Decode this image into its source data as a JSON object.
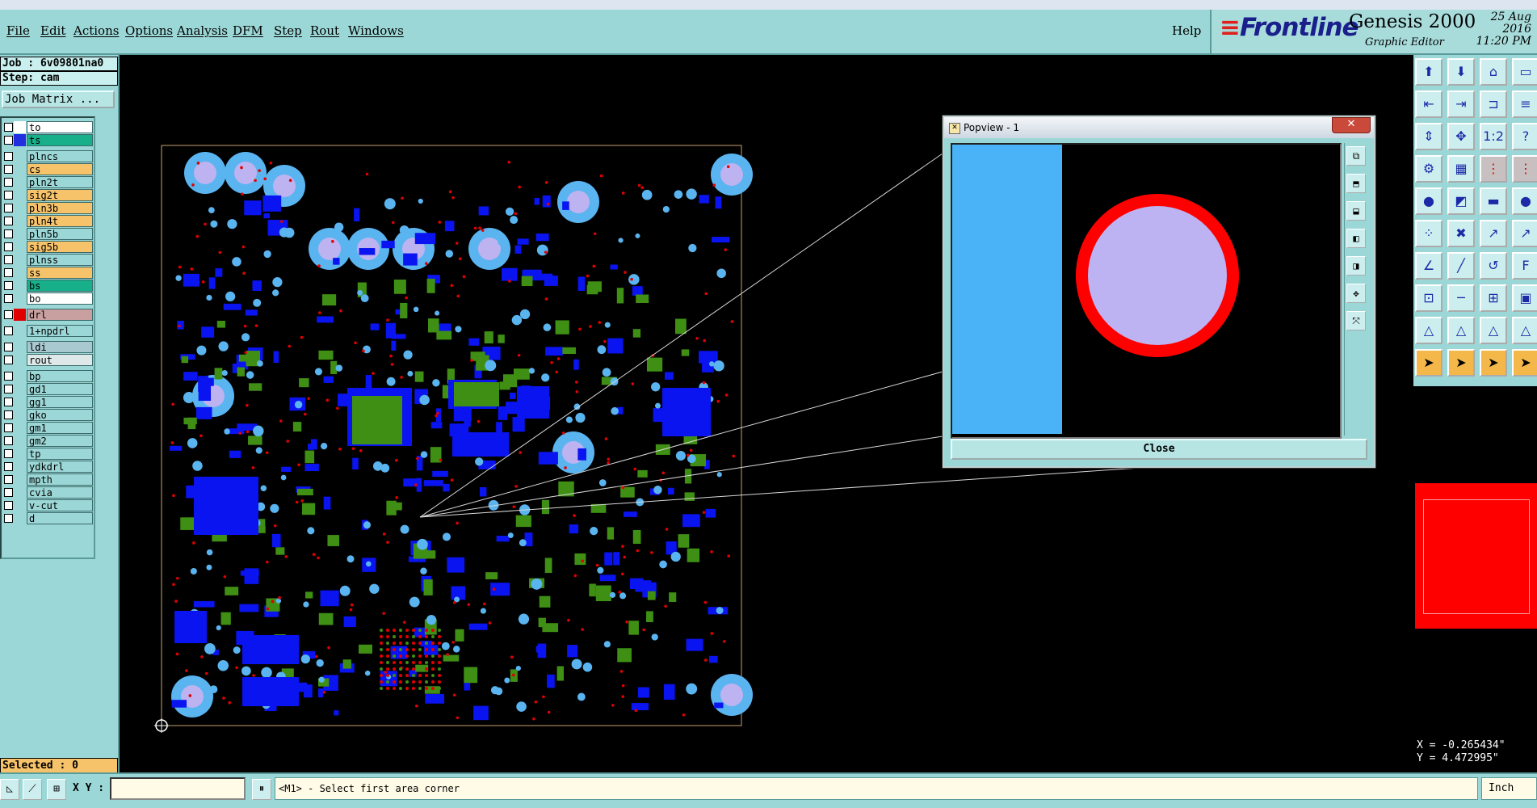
{
  "menu": {
    "items": [
      "File",
      "Edit",
      "Actions",
      "Options",
      "Analysis",
      "DFM",
      "Step",
      "Rout",
      "Windows"
    ],
    "help": "Help"
  },
  "brand": {
    "logo": "Frontline",
    "product": "Genesis 2000",
    "subtitle": "Graphic Editor",
    "date": "25 Aug 2016",
    "time": "11:20 PM"
  },
  "job": {
    "job_line": "Job : 6v09801na0",
    "step_line": "Step: cam",
    "matrix_button": "Job Matrix ..."
  },
  "layers": [
    {
      "name": "to",
      "color": "#ffffff",
      "highlight": "#ffffff"
    },
    {
      "name": "ts",
      "color": "#2030e0",
      "highlight": "#18b08a"
    },
    {
      "name": "plncs",
      "color": "#9bd7d6",
      "highlight": "#9bd7d6"
    },
    {
      "name": "cs",
      "color": "#9bd7d6",
      "highlight": "#f6c36a"
    },
    {
      "name": "pln2t",
      "color": "#9bd7d6",
      "highlight": "#9bd7d6"
    },
    {
      "name": "sig2t",
      "color": "#9bd7d6",
      "highlight": "#f6c36a"
    },
    {
      "name": "pln3b",
      "color": "#9bd7d6",
      "highlight": "#f6c36a"
    },
    {
      "name": "pln4t",
      "color": "#9bd7d6",
      "highlight": "#f6c36a"
    },
    {
      "name": "pln5b",
      "color": "#9bd7d6",
      "highlight": "#9bd7d6"
    },
    {
      "name": "sig5b",
      "color": "#9bd7d6",
      "highlight": "#f6c36a"
    },
    {
      "name": "plnss",
      "color": "#9bd7d6",
      "highlight": "#9bd7d6"
    },
    {
      "name": "ss",
      "color": "#9bd7d6",
      "highlight": "#f6c36a"
    },
    {
      "name": "bs",
      "color": "#9bd7d6",
      "highlight": "#18b08a"
    },
    {
      "name": "bo",
      "color": "#9bd7d6",
      "highlight": "#ffffff"
    },
    {
      "name": "drl",
      "color": "#e00000",
      "highlight": "#c9a0a0"
    },
    {
      "name": "1+npdrl",
      "color": "#9bd7d6",
      "highlight": "#9bd7d6"
    },
    {
      "name": "ldi",
      "color": "#9bd7d6",
      "highlight": "#a9c9d0"
    },
    {
      "name": "rout",
      "color": "#9bd7d6",
      "highlight": "#dfe8e8"
    },
    {
      "name": "bp",
      "color": "#9bd7d6",
      "highlight": "#9bd7d6"
    },
    {
      "name": "gd1",
      "color": "#9bd7d6",
      "highlight": "#9bd7d6"
    },
    {
      "name": "gg1",
      "color": "#9bd7d6",
      "highlight": "#9bd7d6"
    },
    {
      "name": "gko",
      "color": "#9bd7d6",
      "highlight": "#9bd7d6"
    },
    {
      "name": "gm1",
      "color": "#9bd7d6",
      "highlight": "#9bd7d6"
    },
    {
      "name": "gm2",
      "color": "#9bd7d6",
      "highlight": "#9bd7d6"
    },
    {
      "name": "tp",
      "color": "#9bd7d6",
      "highlight": "#9bd7d6"
    },
    {
      "name": "ydkdrl",
      "color": "#9bd7d6",
      "highlight": "#9bd7d6"
    },
    {
      "name": "mpth",
      "color": "#9bd7d6",
      "highlight": "#9bd7d6"
    },
    {
      "name": "cvia",
      "color": "#9bd7d6",
      "highlight": "#9bd7d6"
    },
    {
      "name": "v-cut",
      "color": "#9bd7d6",
      "highlight": "#9bd7d6"
    },
    {
      "name": "d",
      "color": "#9bd7d6",
      "highlight": "#9bd7d6"
    }
  ],
  "status": {
    "selected": "Selected : 0",
    "coord_x": "X = -0.265434\"",
    "coord_y": "Y = 4.472995\"",
    "xy_label": "X Y :",
    "xy_value": "",
    "prompt": "<M1> - Select first area corner",
    "units": "Inch"
  },
  "popview": {
    "title": "Popview - 1",
    "close_button": "Close",
    "close_x": "✕"
  },
  "colors": {
    "panel": "#9bd7d6",
    "pad_light": "#5ab4f0",
    "pad_center": "#bdb3f0",
    "pad_blue": "#0a14f0",
    "pad_green": "#3f8f14",
    "drill_red": "#e00000"
  }
}
